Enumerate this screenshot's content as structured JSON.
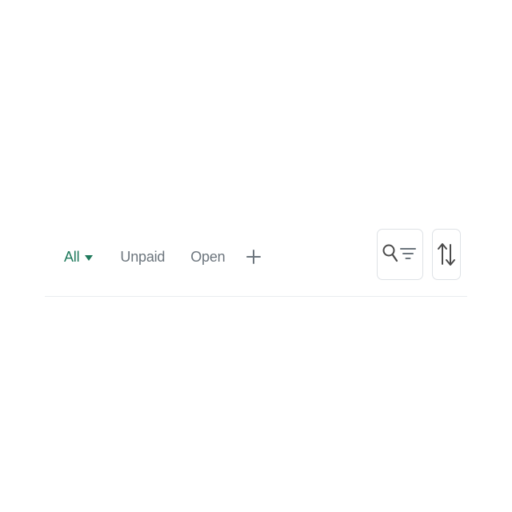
{
  "tabs": {
    "items": [
      {
        "label": "All",
        "active": true
      },
      {
        "label": "Unpaid",
        "active": false
      },
      {
        "label": "Open",
        "active": false
      }
    ],
    "add_icon": "plus-icon"
  },
  "toolbar": {
    "search_filter_icon": "search-filter-icon",
    "sort_icon": "sort-arrows-icon"
  },
  "colors": {
    "accent": "#1f7a5c",
    "muted_text": "#6c757d",
    "border": "#dee2e6",
    "divider": "#e9ecef"
  }
}
